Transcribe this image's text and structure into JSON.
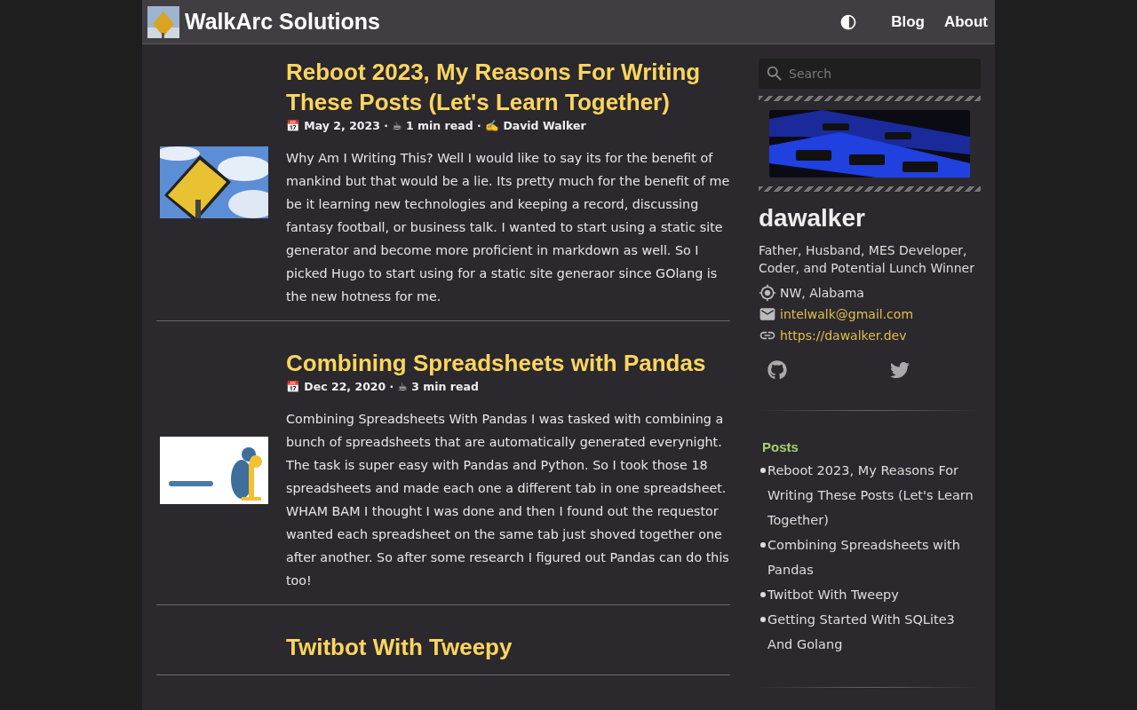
{
  "site": {
    "title": "WalkArc Solutions"
  },
  "nav": [
    {
      "label": "Blog"
    },
    {
      "label": "About"
    }
  ],
  "posts": [
    {
      "title": "Reboot 2023, My Reasons For Writing These Posts (Let's Learn Together)",
      "meta": "📅 May 2, 2023 · ☕ 1 min read · ✍️ David Walker",
      "summary": "Why Am I Writing This? Well I would like to say its for the benefit of mankind but that would be a lie. Its pretty much for the benefit of me be it learning new technologies and keeping a record, discussing fantasy football, or business talk. I wanted to start using a static site generator and become more proficient in markdown as well. So I picked Hugo to start using for a static site generaor since GOlang is the new hotness for me."
    },
    {
      "title": "Combining Spreadsheets with Pandas",
      "meta": "📅 Dec 22, 2020 · ☕ 3 min read",
      "summary": "Combining Spreadsheets With Pandas I was tasked with combining a bunch of spreadsheets that are automatically generated everynight. The task is super easy with Pandas and Python. So I took those 18 spreadsheets and made each one a different tab in one spreadsheet. WHAM BAM I thought I was done and then I found out the requestor wanted each spreadsheet on the same tab just shoved together one after another. So after some research I figured out Pandas can do this too!"
    },
    {
      "title": "Twitbot With Tweepy"
    }
  ],
  "sidebar": {
    "search": {
      "placeholder": "Search"
    },
    "name": "dawalker",
    "bio": "Father, Husband, MES Developer, Coder, and Potential Lunch Winner",
    "contacts": [
      {
        "kind": "location",
        "text": "NW, Alabama"
      },
      {
        "kind": "email",
        "text": "intelwalk@gmail.com"
      },
      {
        "kind": "link",
        "text": "https://dawalker.dev"
      }
    ],
    "posts_heading": "Posts",
    "recent_posts": [
      "Reboot 2023, My Reasons For Writing These Posts (Let's Learn Together)",
      "Combining Spreadsheets with Pandas",
      "Twitbot With Tweepy",
      "Getting Started With SQLite3 And Golang"
    ]
  }
}
